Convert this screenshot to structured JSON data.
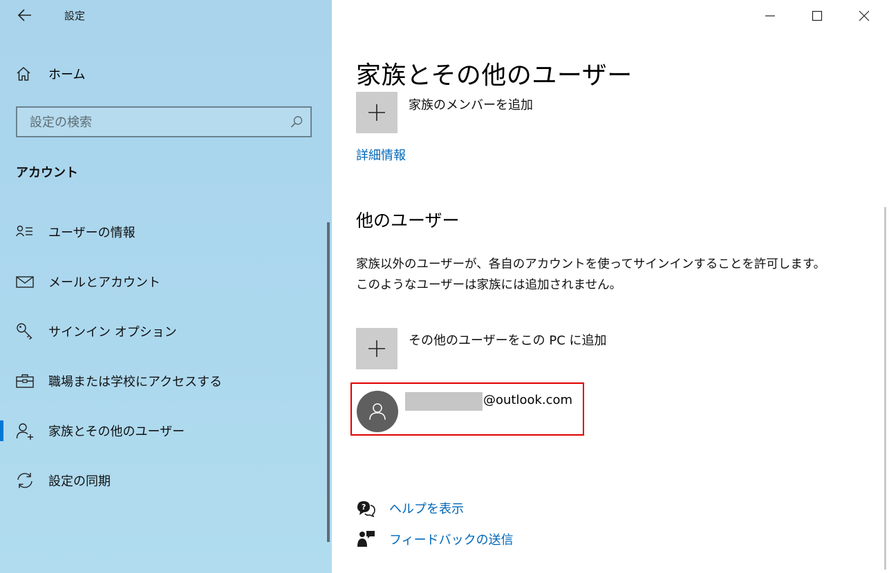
{
  "window": {
    "title": "設定",
    "minimize": "minimize",
    "maximize": "maximize",
    "close": "close"
  },
  "sidebar": {
    "home_label": "ホーム",
    "search_placeholder": "設定の検索",
    "section_title": "アカウント",
    "items": [
      {
        "label": "ユーザーの情報",
        "icon": "user-info-icon"
      },
      {
        "label": "メールとアカウント",
        "icon": "mail-icon"
      },
      {
        "label": "サインイン オプション",
        "icon": "key-icon"
      },
      {
        "label": "職場または学校にアクセスする",
        "icon": "briefcase-icon"
      },
      {
        "label": "家族とその他のユーザー",
        "icon": "family-icon",
        "selected": true
      },
      {
        "label": "設定の同期",
        "icon": "sync-icon"
      }
    ],
    "accent": "#0078d4"
  },
  "main": {
    "title": "家族とその他のユーザー",
    "add_family_label": "家族のメンバーを追加",
    "more_info_link": "詳細情報",
    "other_users_heading": "他のユーザー",
    "other_users_desc": "家族以外のユーザーが、各自のアカウントを使ってサインインすることを許可します。このようなユーザーは家族には追加されません。",
    "add_other_user_label": "その他のユーザーをこの PC に追加",
    "user_account": {
      "email_suffix": "@outlook.com"
    },
    "help_link": "ヘルプを表示",
    "feedback_link": "フィードバックの送信"
  }
}
